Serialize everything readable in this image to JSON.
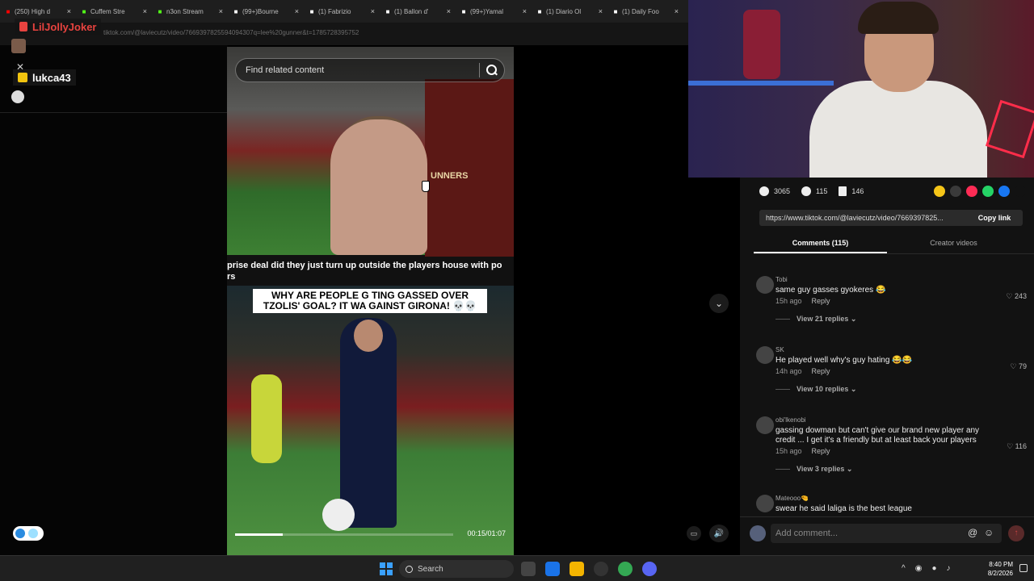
{
  "browser": {
    "tabs": [
      {
        "title": "(250) High d",
        "color": "#ff0000",
        "icon": "youtube-icon"
      },
      {
        "title": "Cuffem Stre",
        "color": "#53fc18",
        "icon": "kick-icon"
      },
      {
        "title": "n3on Stream",
        "color": "#53fc18",
        "icon": "kick-icon"
      },
      {
        "title": "(99+)Bourne",
        "color": "#ffffff",
        "icon": "tiktok-icon"
      },
      {
        "title": "(1) Fabrizio",
        "color": "#ffffff",
        "icon": "x-icon"
      },
      {
        "title": "(1) Ballon d'",
        "color": "#ffffff",
        "icon": "x-icon"
      },
      {
        "title": "(99+)Yamal",
        "color": "#ffffff",
        "icon": "tiktok-icon"
      },
      {
        "title": "(1) Diario Ol",
        "color": "#ffffff",
        "icon": "x-icon"
      },
      {
        "title": "(1) Daily Foo",
        "color": "#ffffff",
        "icon": "x-icon"
      }
    ],
    "url": "tiktok.com/@laviecutz/video/7669397825594094307q=lee%20gunner&t=1785728395752"
  },
  "chat": {
    "user1": "LilJollyJoker",
    "user2": "lukca43"
  },
  "video": {
    "search_placeholder": "Find related content",
    "sign_text": "UNNERS",
    "caption": "prise deal did they just turn up outside the players house with po",
    "caption_line2": "rs",
    "headline": "WHY ARE PEOPLE G TING GASSED OVER TZOLIS' GOAL? IT WA   GAINST GIRONA! 💀💀",
    "time": "00:15/01:07",
    "progress": 0.22
  },
  "post": {
    "likes": "3065",
    "comments": "115",
    "saves": "146",
    "link": "https://www.tiktok.com/@laviecutz/video/7669397825...",
    "copy_label": "Copy link",
    "tab_comments": "Comments (115)",
    "tab_creator": "Creator videos",
    "share_colors": [
      "#f5c518",
      "#3a3a3a",
      "#fe2c55",
      "#25d366",
      "#1877f2",
      "#121212"
    ]
  },
  "comments": [
    {
      "user": "Tobi",
      "text": "same guy gasses gyokeres 😂",
      "time": "15h ago",
      "reply": "Reply",
      "likes": "243",
      "replies": "View 21 replies"
    },
    {
      "user": "SK",
      "text": "He played well why's guy hating 😂😂",
      "time": "14h ago",
      "reply": "Reply",
      "likes": "79",
      "replies": "View 10 replies"
    },
    {
      "user": "obi'lkenobi",
      "text": "gassing dowman but can't give our brand new player any credit ... I get it's a friendly but at least back your players",
      "time": "15h ago",
      "reply": "Reply",
      "likes": "116",
      "replies": "View 3 replies"
    },
    {
      "user": "Mateooo🤏",
      "text": "swear he said laliga is the best league",
      "time": "",
      "reply": "",
      "likes": "",
      "replies": ""
    }
  ],
  "add_comment": "Add comment...",
  "taskbar": {
    "search": "Search",
    "time": "8:40 PM",
    "date": "8/2/2026"
  }
}
